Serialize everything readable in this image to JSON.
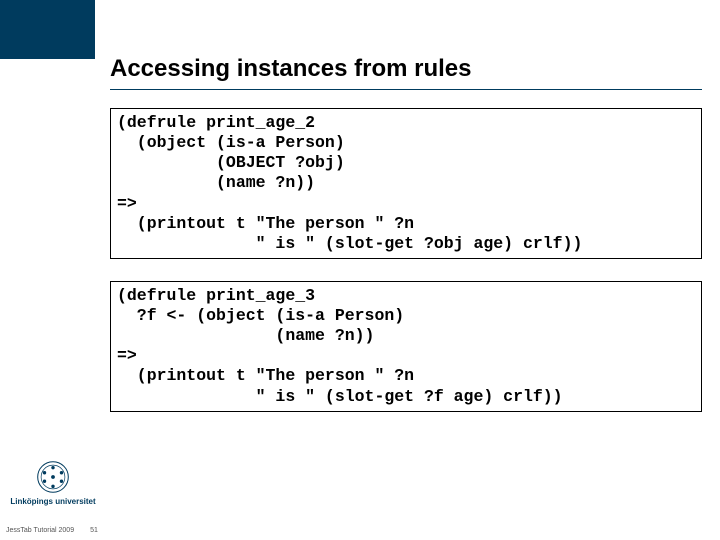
{
  "slide": {
    "title": "Accessing instances from rules",
    "code1": "(defrule print_age_2\n  (object (is-a Person)\n          (OBJECT ?obj)\n          (name ?n))\n=>\n  (printout t \"The person \" ?n\n              \" is \" (slot-get ?obj age) crlf))",
    "code2": "(defrule print_age_3\n  ?f <- (object (is-a Person)\n                (name ?n))\n=>\n  (printout t \"The person \" ?n\n              \" is \" (slot-get ?f age) crlf))"
  },
  "branding": {
    "university": "Linköpings universitet"
  },
  "footer": {
    "label": "JessTab Tutorial 2009",
    "page": "51"
  }
}
